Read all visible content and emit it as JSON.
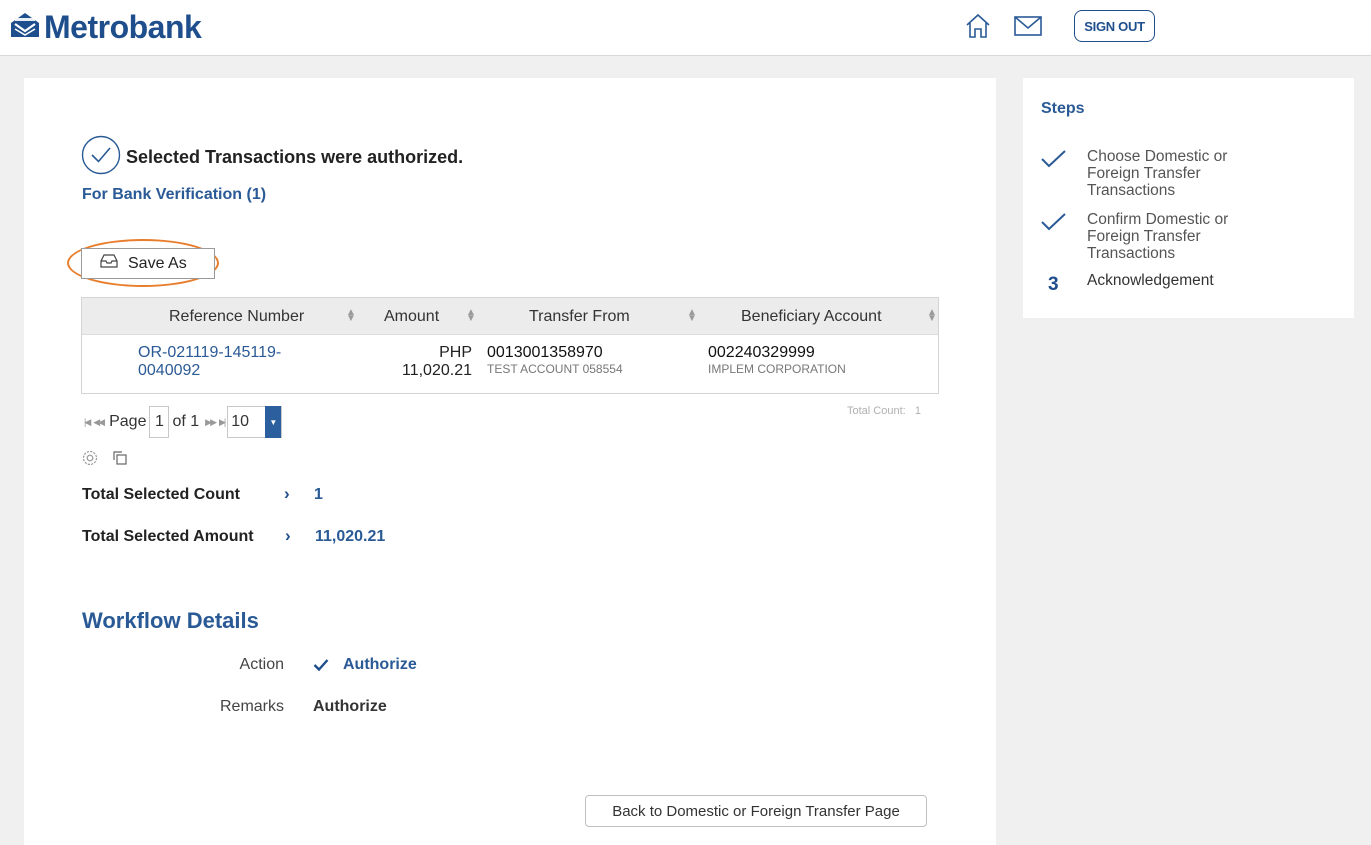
{
  "header": {
    "logo_text": "Metrobank",
    "signout_label": "SIGN OUT",
    "colors": {
      "brand": "#1f4e8c",
      "accent": "#e87e2c"
    }
  },
  "main": {
    "success_message": "Selected Transactions were authorized.",
    "verification_link": "For Bank Verification (1)",
    "save_as_label": "Save As",
    "table": {
      "columns": [
        "Reference Number",
        "Amount",
        "Transfer From",
        "Beneficiary Account"
      ],
      "rows": [
        {
          "reference_line1": "OR-021119-145119-",
          "reference_line2": "0040092",
          "currency": "PHP",
          "amount": "11,020.21",
          "from_account": "0013001358970",
          "from_name": "TEST ACCOUNT 058554",
          "beneficiary_account": "002240329999",
          "beneficiary_name": "IMPLEM CORPORATION"
        }
      ]
    },
    "pager": {
      "page_label": "Page",
      "page_value": "1",
      "of_label": "of 1",
      "page_size": "10",
      "total_count_label": "Total Count:",
      "total_count_value": "1"
    },
    "summary": {
      "count_label": "Total Selected Count",
      "count_value": "1",
      "amount_label": "Total Selected Amount",
      "amount_value": "11,020.21"
    },
    "workflow": {
      "title": "Workflow Details",
      "action_label": "Action",
      "action_value": "Authorize",
      "remarks_label": "Remarks",
      "remarks_value": "Authorize"
    },
    "back_button_label": "Back to Domestic or Foreign Transfer Page"
  },
  "steps": {
    "title": "Steps",
    "items": [
      {
        "status": "done",
        "label_line1": "Choose Domestic or",
        "label_line2": "Foreign Transfer",
        "label_line3": "Transactions"
      },
      {
        "status": "done",
        "label_line1": "Confirm Domestic or",
        "label_line2": "Foreign Transfer",
        "label_line3": "Transactions"
      },
      {
        "status": "current",
        "number": "3",
        "label_line1": "Acknowledgement"
      }
    ]
  }
}
